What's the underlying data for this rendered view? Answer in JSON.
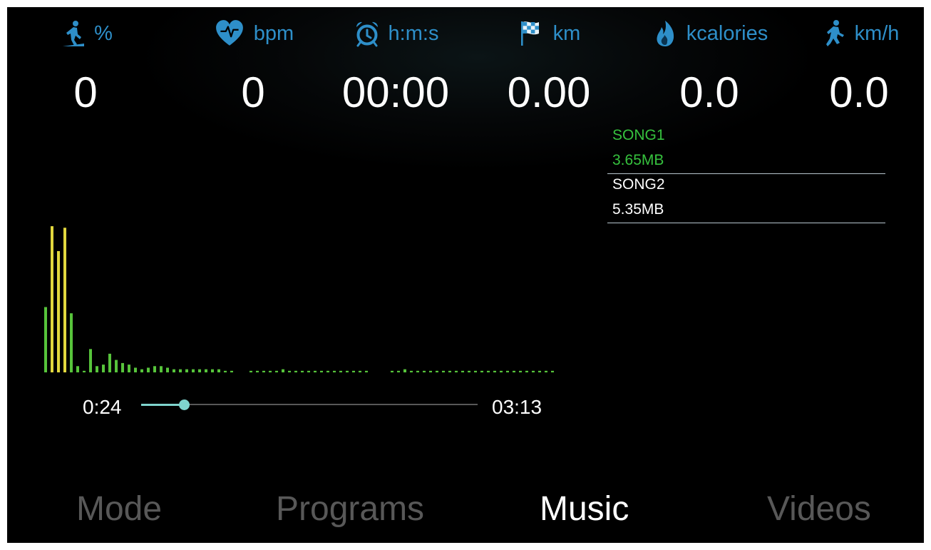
{
  "colors": {
    "accent_blue": "#2e8fc9",
    "active_song": "#36c23e",
    "spectrum_green": "#57c43b",
    "spectrum_yellow": "#e2d83e",
    "seek": "#7fd4cd",
    "tab_inactive": "#585858",
    "tab_active": "#ffffff"
  },
  "stats": {
    "incline": {
      "icon": "walker-incline-icon",
      "unit": "%",
      "value": "0"
    },
    "heart": {
      "icon": "heart-rate-icon",
      "unit": "bpm",
      "value": "0"
    },
    "time": {
      "icon": "alarm-clock-icon",
      "unit": "h:m:s",
      "value": "00:00"
    },
    "distance": {
      "icon": "checkered-flag-icon",
      "unit": "km",
      "value": "0.00"
    },
    "calories": {
      "icon": "flame-icon",
      "unit": "kcalories",
      "value": "0.0"
    },
    "speed": {
      "icon": "runner-icon",
      "unit": "km/h",
      "value": "0.0"
    }
  },
  "playlist": [
    {
      "name": "SONG1",
      "size": "3.65MB",
      "active": true
    },
    {
      "name": "SONG2",
      "size": "5.35MB",
      "active": false
    }
  ],
  "player": {
    "elapsed": "0:24",
    "duration": "03:13",
    "progress": 0.128
  },
  "spectrum": {
    "levels": [
      0.42,
      0.94,
      0.78,
      0.93,
      0.38,
      0.04,
      0.01,
      0.15,
      0.04,
      0.05,
      0.12,
      0.08,
      0.06,
      0.05,
      0.03,
      0.02,
      0.03,
      0.04,
      0.04,
      0.03,
      0.02,
      0.02,
      0.02,
      0.02,
      0.02,
      0.02,
      0.02,
      0.02,
      0.01,
      0.01,
      0.0,
      0.0,
      0.01,
      0.01,
      0.01,
      0.01,
      0.01,
      0.02,
      0.01,
      0.01,
      0.01,
      0.01,
      0.01,
      0.01,
      0.01,
      0.01,
      0.01,
      0.01,
      0.01,
      0.01,
      0.01,
      0.0,
      0.0,
      0.0,
      0.01,
      0.01,
      0.02,
      0.01,
      0.01,
      0.01,
      0.01,
      0.01,
      0.01,
      0.01,
      0.01,
      0.01,
      0.01,
      0.01,
      0.01,
      0.01,
      0.01,
      0.01,
      0.01,
      0.01,
      0.01,
      0.01,
      0.01,
      0.01,
      0.01,
      0.01
    ],
    "peak_bars": [
      1,
      2,
      3
    ]
  },
  "tabs": [
    {
      "id": "mode",
      "label": "Mode",
      "selected": false
    },
    {
      "id": "programs",
      "label": "Programs",
      "selected": false
    },
    {
      "id": "music",
      "label": "Music",
      "selected": true
    },
    {
      "id": "videos",
      "label": "Videos",
      "selected": false
    }
  ]
}
